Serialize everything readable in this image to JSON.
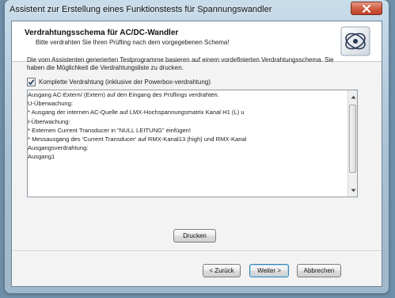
{
  "window": {
    "title": "Assistent zur Erstellung eines Funktionstests für Spannungswandler"
  },
  "header": {
    "title": "Verdrahtungsschema für AC/DC-Wandler",
    "subtitle": "Bitte verdrahten Sie Ihren Prüfling nach dem vorgegebenen Schema!"
  },
  "intro": {
    "text": "Die vom Assistenten generierten Testprogramme basieren auf einem vordefinierten Verdrahtungsschema. Sie haben die Möglichkeit die Verdrahtungsliste zu drucken."
  },
  "checkbox": {
    "label": "Komplette Verdrahtung (inklusive der Powerbox-verdrahtung)",
    "checked": true
  },
  "wiring_list": {
    "lines": [
      "     Ausgang AC-Extern/ (Extern) auf den Eingang des Prüflings verdrahten.",
      "     U-Überwachung:",
      "          * Ausgang der internen AC-Quelle auf LMX-Hochspannungsmatrix Kanal H1 (L) u",
      "     I-Überwachung:",
      "          * Externen Current Transducer in \"NULL LEITUNG\" einfügen!",
      "          * Messausgang des 'Current Transducer' auf RMX-Kanal13 (high) und RMX-Kanal",
      "Ausgangsverdrahtung:",
      "     Ausgang1"
    ]
  },
  "buttons": {
    "print": "Drucken",
    "back": "< Zurück",
    "next": "Weiter >",
    "cancel": "Abbrechen"
  },
  "colors": {
    "close_button": "#c9442b",
    "default_button_border": "#3c7fb1"
  }
}
